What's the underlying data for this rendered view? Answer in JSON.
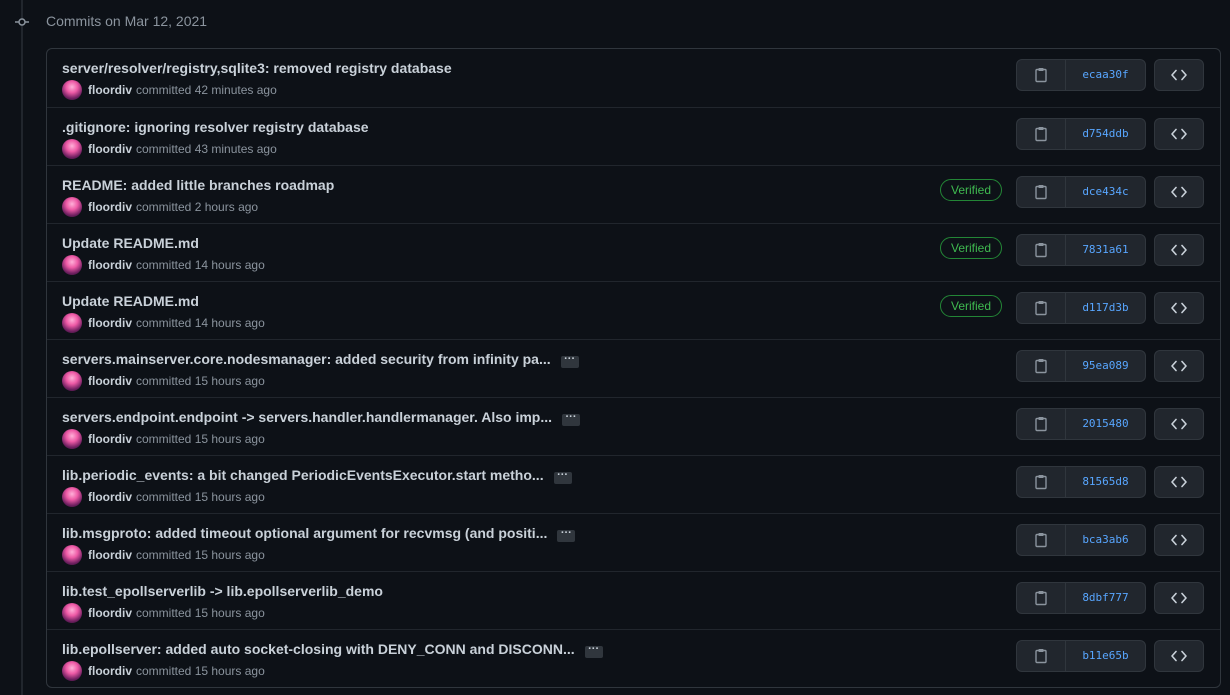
{
  "group": {
    "title": "Commits on Mar 12, 2021",
    "timeline_icon": "git-commit-icon"
  },
  "icons": {
    "copy": "clipboard-icon",
    "browse": "code-icon",
    "expand": "ellipsis-icon"
  },
  "colors": {
    "sha": "#58a6ff",
    "verified": "#3fb950",
    "verified_border": "#238636"
  },
  "commits": [
    {
      "message": "server/resolver/registry,sqlite3: removed registry database",
      "truncated": false,
      "author": "floordiv",
      "action": "committed",
      "time": "42 minutes ago",
      "verified": false,
      "sha": "ecaa30f"
    },
    {
      "message": ".gitignore: ignoring resolver registry database",
      "truncated": false,
      "author": "floordiv",
      "action": "committed",
      "time": "43 minutes ago",
      "verified": false,
      "sha": "d754ddb"
    },
    {
      "message": "README: added little branches roadmap",
      "truncated": false,
      "author": "floordiv",
      "action": "committed",
      "time": "2 hours ago",
      "verified": true,
      "verified_label": "Verified",
      "sha": "dce434c"
    },
    {
      "message": "Update README.md",
      "truncated": false,
      "author": "floordiv",
      "action": "committed",
      "time": "14 hours ago",
      "verified": true,
      "verified_label": "Verified",
      "sha": "7831a61"
    },
    {
      "message": "Update README.md",
      "truncated": false,
      "author": "floordiv",
      "action": "committed",
      "time": "14 hours ago",
      "verified": true,
      "verified_label": "Verified",
      "sha": "d117d3b"
    },
    {
      "message": "servers.mainserver.core.nodesmanager: added security from infinity pa...",
      "truncated": true,
      "author": "floordiv",
      "action": "committed",
      "time": "15 hours ago",
      "verified": false,
      "sha": "95ea089"
    },
    {
      "message": "servers.endpoint.endpoint -> servers.handler.handlermanager. Also imp...",
      "truncated": true,
      "author": "floordiv",
      "action": "committed",
      "time": "15 hours ago",
      "verified": false,
      "sha": "2015480"
    },
    {
      "message": "lib.periodic_events: a bit changed PeriodicEventsExecutor.start metho...",
      "truncated": true,
      "author": "floordiv",
      "action": "committed",
      "time": "15 hours ago",
      "verified": false,
      "sha": "81565d8"
    },
    {
      "message": "lib.msgproto: added timeout optional argument for recvmsg (and positi...",
      "truncated": true,
      "author": "floordiv",
      "action": "committed",
      "time": "15 hours ago",
      "verified": false,
      "sha": "bca3ab6"
    },
    {
      "message": "lib.test_epollserverlib -> lib.epollserverlib_demo",
      "truncated": false,
      "author": "floordiv",
      "action": "committed",
      "time": "15 hours ago",
      "verified": false,
      "sha": "8dbf777"
    },
    {
      "message": "lib.epollserver: added auto socket-closing with DENY_CONN and DISCONN...",
      "truncated": true,
      "author": "floordiv",
      "action": "committed",
      "time": "15 hours ago",
      "verified": false,
      "sha": "b11e65b"
    }
  ]
}
